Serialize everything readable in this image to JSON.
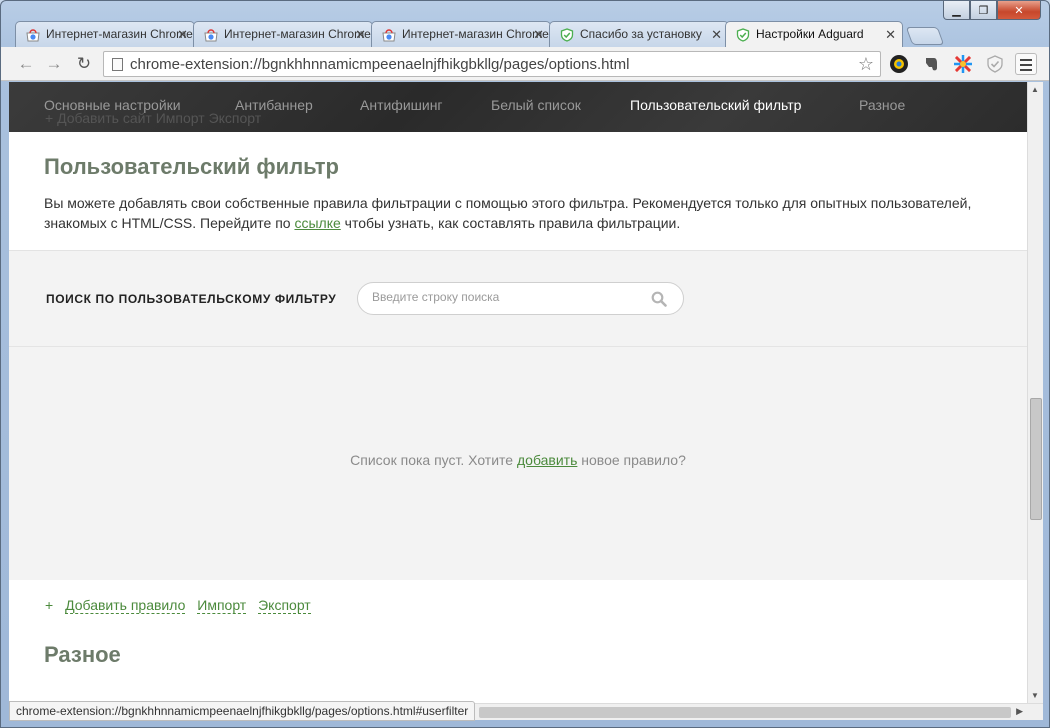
{
  "window": {
    "minimize_label": "▁",
    "maximize_label": "❐",
    "close_label": "✕"
  },
  "tabs": [
    {
      "title": "Интернет-магазин Chrome",
      "icon": "chrome-store-icon"
    },
    {
      "title": "Интернет-магазин Chrome",
      "icon": "chrome-store-icon"
    },
    {
      "title": "Интернет-магазин Chrome",
      "icon": "chrome-store-icon"
    },
    {
      "title": "Спасибо за установку",
      "icon": "adguard-shield-icon"
    },
    {
      "title": "Настройки Adguard",
      "icon": "adguard-shield-icon",
      "active": true
    }
  ],
  "toolbar": {
    "url": "chrome-extension://bgnkhhnnamicmpeenaelnjfhikgbkllg/pages/options.html"
  },
  "nav": {
    "items": [
      "Основные настройки",
      "Антибаннер",
      "Антифишинг",
      "Белый список",
      "Пользовательский фильтр",
      "Разное"
    ],
    "active_index": 4,
    "ghost_text": "+ Добавить сайт   Импорт   Экспорт"
  },
  "user_filter": {
    "title": "Пользовательский фильтр",
    "description_before": "Вы можете добавлять свои собственные правила фильтрации с помощью этого фильтра. Рекомендуется только для опытных пользователей, знакомых с HTML/CSS. Перейдите по ",
    "description_link": "ссылке",
    "description_after": " чтобы узнать, как составлять правила фильтрации.",
    "search_label": "ПОИСК ПО ПОЛЬЗОВАТЕЛЬСКОМУ ФИЛЬТРУ",
    "search_placeholder": "Введите строку поиска",
    "search_value": "",
    "empty_before": "Список пока пуст. Хотите ",
    "empty_link": "добавить",
    "empty_after": " новое правило?",
    "add_rule": "Добавить правило",
    "import": "Импорт",
    "export": "Экспорт",
    "plus": "+"
  },
  "misc": {
    "title": "Разное"
  },
  "statusbar": {
    "text": "chrome-extension://bgnkhhnnamicmpeenaelnjfhikgbkllg/pages/options.html#userfilter"
  },
  "colors": {
    "accent_green": "#4b8a3c",
    "section_title": "#6d7b6a",
    "navbar_bg": "#2f2f2f"
  }
}
